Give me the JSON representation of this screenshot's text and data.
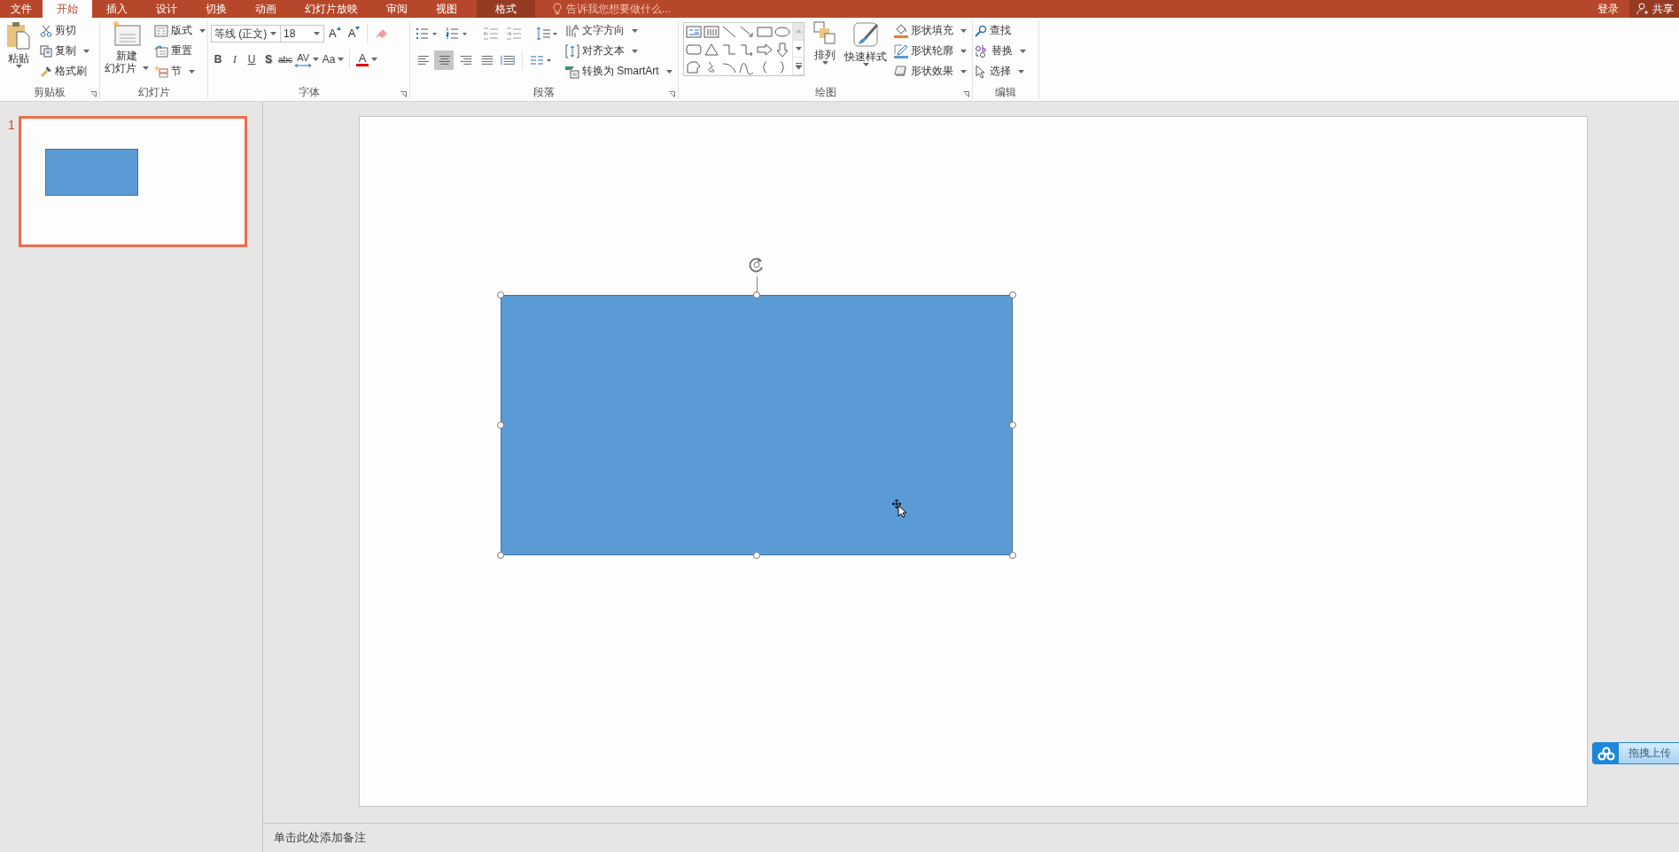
{
  "tabs": [
    {
      "label": "文件",
      "kind": "file",
      "selected": false
    },
    {
      "label": "开始",
      "kind": "normal",
      "selected": true
    },
    {
      "label": "插入",
      "kind": "normal",
      "selected": false
    },
    {
      "label": "设计",
      "kind": "normal",
      "selected": false
    },
    {
      "label": "切换",
      "kind": "normal",
      "selected": false
    },
    {
      "label": "动画",
      "kind": "normal",
      "selected": false
    },
    {
      "label": "幻灯片放映",
      "kind": "normal",
      "selected": false
    },
    {
      "label": "审阅",
      "kind": "normal",
      "selected": false
    },
    {
      "label": "视图",
      "kind": "normal",
      "selected": false
    },
    {
      "label": "格式",
      "kind": "context",
      "selected": false
    }
  ],
  "tell_me": {
    "placeholder": "告诉我您想要做什么..."
  },
  "account": {
    "sign_in": "登录",
    "share": "共享"
  },
  "ribbon": {
    "clipboard": {
      "label": "剪贴板",
      "paste": "粘贴",
      "cut": "剪切",
      "copy": "复制",
      "format_painter": "格式刷"
    },
    "slides": {
      "label": "幻灯片",
      "new_slide": [
        "新建",
        "幻灯片"
      ],
      "layout": "版式",
      "reset": "重置",
      "section": "节"
    },
    "font": {
      "label": "字体",
      "font_name": "等线 (正文)",
      "font_size": "18",
      "grow": "A",
      "shrink": "A",
      "styles": [
        {
          "text": "B",
          "kind": "bold"
        },
        {
          "text": "I",
          "kind": "italic"
        },
        {
          "text": "U",
          "kind": "underline"
        },
        {
          "text": "S",
          "kind": "shadow"
        },
        {
          "text": "abc",
          "kind": "strike"
        },
        {
          "text": "AV",
          "kind": "spacing"
        },
        {
          "text": "Aa",
          "kind": "case"
        },
        {
          "text": "A",
          "kind": "color"
        }
      ]
    },
    "paragraph": {
      "label": "段落",
      "alignment": [
        {
          "kind": "left",
          "selected": false
        },
        {
          "kind": "center",
          "selected": true
        },
        {
          "kind": "right",
          "selected": false
        },
        {
          "kind": "justify",
          "selected": false
        },
        {
          "kind": "distributed",
          "selected": false
        }
      ],
      "text_direction": "文字方向",
      "align_text": "对齐文本",
      "smartart": "转换为 SmartArt"
    },
    "drawing": {
      "label": "绘图",
      "arrange": "排列",
      "quick_styles": "快速样式",
      "shape_fill": "形状填充",
      "shape_outline": "形状轮廓",
      "shape_effects": "形状效果"
    },
    "editing": {
      "label": "编辑",
      "find": "查找",
      "replace": "替换",
      "select": "选择"
    }
  },
  "thumbnails": [
    {
      "number": "1",
      "selected": true
    }
  ],
  "notes": {
    "placeholder": "单击此处添加备注"
  },
  "upload_widget": {
    "label": "拖拽上传"
  }
}
